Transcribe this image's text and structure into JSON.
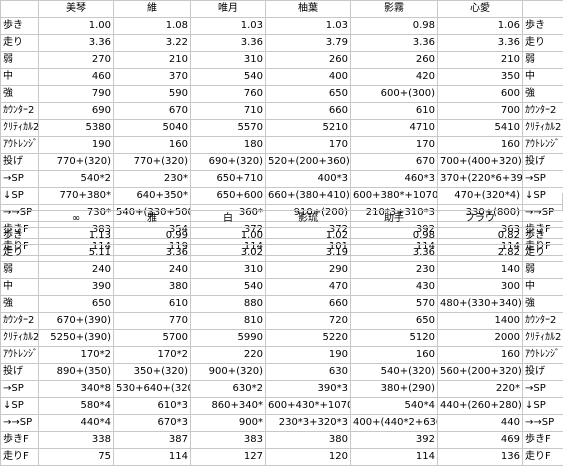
{
  "top": {
    "headers": [
      "",
      "美琴",
      "維",
      "唯月",
      "柚葉",
      "影霧",
      "心愛",
      ""
    ],
    "rows": [
      {
        "label": "歩き",
        "values": [
          "1.00",
          "1.08",
          "1.03",
          "1.03",
          "0.98",
          "1.06"
        ],
        "label_right": "歩き"
      },
      {
        "label": "走り",
        "values": [
          "3.36",
          "3.22",
          "3.36",
          "3.79",
          "3.36",
          "3.36"
        ],
        "label_right": "走り"
      },
      {
        "label": "弱",
        "values": [
          "270",
          "210",
          "310",
          "260",
          "260",
          "210"
        ],
        "label_right": "弱"
      },
      {
        "label": "中",
        "values": [
          "460",
          "370",
          "540",
          "400",
          "420",
          "350"
        ],
        "label_right": "中"
      },
      {
        "label": "強",
        "values": [
          "790",
          "590",
          "760",
          "650",
          "600+(300)",
          "600"
        ],
        "label_right": "強"
      },
      {
        "label": "ｶｳﾝﾀｰ2",
        "values": [
          "690",
          "670",
          "710",
          "660",
          "610",
          "700"
        ],
        "label_right": "ｶｳﾝﾀｰ2"
      },
      {
        "label": "ｸﾘﾃｨｶﾙ2",
        "values": [
          "5380",
          "5040",
          "5570",
          "5210",
          "4710",
          "5410"
        ],
        "label_right": "ｸﾘﾃｨｶﾙ2"
      },
      {
        "label": "ｱｳﾄﾚﾝｼﾞ",
        "values": [
          "190",
          "160",
          "180",
          "170",
          "170",
          "160"
        ],
        "label_right": "ｱｳﾄﾚﾝｼﾞ"
      },
      {
        "label": "投げ",
        "values": [
          "770+(320)",
          "770+(320)",
          "690+(320)",
          "520+(200+360)",
          "670",
          "700+(400+320)"
        ],
        "label_right": "投げ"
      },
      {
        "label": "→SP",
        "values": [
          "540*2",
          "230*",
          "650+710",
          "400*3",
          "460*3",
          "370+(220*6+390)"
        ],
        "label_right": "→SP"
      },
      {
        "label": "↓SP",
        "values": [
          "770+380*",
          "640+350*",
          "650+600",
          "660+(380+410)",
          "600+380*+1070",
          "470+(320*4)"
        ],
        "label_right": "↓SP"
      },
      {
        "label": "→→SP",
        "values": [
          "730*",
          "540+(330+500)",
          "360*",
          "910+(200)",
          "210*3+310*3",
          "330+(800)"
        ],
        "label_right": "→→SP"
      },
      {
        "label": "歩きF",
        "values": [
          "383",
          "354",
          "372",
          "372",
          "392",
          "363"
        ],
        "label_right": "歩きF"
      },
      {
        "label": "走りF",
        "values": [
          "114",
          "119",
          "114",
          "101",
          "114",
          "114"
        ],
        "label_right": "走りF"
      }
    ]
  },
  "bottom": {
    "headers": [
      "",
      "∞",
      "雅",
      "白",
      "影琉",
      "助手",
      "フラウ",
      ""
    ],
    "rows": [
      {
        "label": "歩き",
        "values": [
          "1.13",
          "0.99",
          "1.00",
          "1.02",
          "0.98",
          "0.82"
        ],
        "label_right": "歩き"
      },
      {
        "label": "走り",
        "values": [
          "5.11",
          "3.36",
          "3.02",
          "3.19",
          "3.36",
          "2.82"
        ],
        "label_right": "走り"
      },
      {
        "label": "弱",
        "values": [
          "240",
          "240",
          "310",
          "290",
          "230",
          "140"
        ],
        "label_right": "弱"
      },
      {
        "label": "中",
        "values": [
          "390",
          "380",
          "540",
          "470",
          "430",
          "300"
        ],
        "label_right": "中"
      },
      {
        "label": "強",
        "values": [
          "650",
          "610",
          "880",
          "660",
          "570",
          "480+(330+340)"
        ],
        "label_right": "強"
      },
      {
        "label": "ｶｳﾝﾀｰ2",
        "values": [
          "670+(390)",
          "770",
          "810",
          "720",
          "650",
          "1400"
        ],
        "label_right": "ｶｳﾝﾀｰ2"
      },
      {
        "label": "ｸﾘﾃｨｶﾙ2",
        "values": [
          "5250+(390)",
          "5700",
          "5990",
          "5220",
          "5120",
          "2000"
        ],
        "label_right": "ｸﾘﾃｨｶﾙ2"
      },
      {
        "label": "ｱｳﾄﾚﾝｼﾞ",
        "values": [
          "170*2",
          "170*2",
          "220",
          "190",
          "160",
          "160"
        ],
        "label_right": "ｱｳﾄﾚﾝｼﾞ"
      },
      {
        "label": "投げ",
        "values": [
          "890+(350)",
          "350+(320)",
          "900+(320)",
          "630",
          "540+(320)",
          "560+(200+320)"
        ],
        "label_right": "投げ"
      },
      {
        "label": "→SP",
        "values": [
          "340*8",
          "530+640+(320)",
          "630*2",
          "390*3",
          "380+(290)",
          "220*"
        ],
        "label_right": "→SP"
      },
      {
        "label": "↓SP",
        "values": [
          "580*4",
          "610*3",
          "860+340*",
          "600+430*+1070",
          "540*4",
          "440+(260+280)"
        ],
        "label_right": "↓SP"
      },
      {
        "label": "→→SP",
        "values": [
          "440*4",
          "670*3",
          "900*",
          "230*3+320*3",
          "400+(440*2+630)",
          "440"
        ],
        "label_right": "→→SP"
      },
      {
        "label": "歩きF",
        "values": [
          "338",
          "387",
          "383",
          "380",
          "392",
          "469"
        ],
        "label_right": "歩きF"
      },
      {
        "label": "走りF",
        "values": [
          "75",
          "114",
          "127",
          "120",
          "114",
          "136"
        ],
        "label_right": "走りF"
      }
    ]
  }
}
